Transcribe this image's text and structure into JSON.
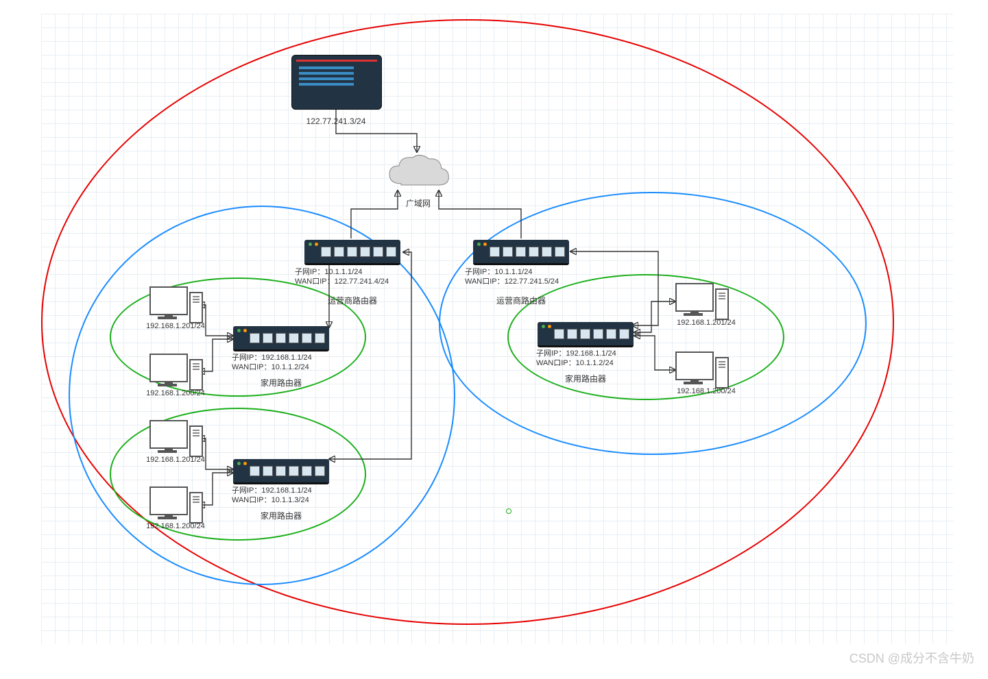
{
  "watermark": "CSDN @成分不含牛奶",
  "server": {
    "ip": "122.77.241.3/24"
  },
  "cloud": {
    "label": "广域网"
  },
  "ispRouterLeft": {
    "subnet": "子网IP：10.1.1.1/24",
    "wan": "WAN口IP：122.77.241.4/24",
    "title": "运营商路由器"
  },
  "ispRouterRight": {
    "subnet": "子网IP：10.1.1.1/24",
    "wan": "WAN口IP：122.77.241.5/24",
    "title": "运营商路由器"
  },
  "homeRouterA": {
    "subnet": "子网IP：192.168.1.1/24",
    "wan": "WAN口IP：10.1.1.2/24",
    "title": "家用路由器"
  },
  "homeRouterB": {
    "subnet": "子网IP：192.168.1.1/24",
    "wan": "WAN口IP：10.1.1.3/24",
    "title": "家用路由器"
  },
  "homeRouterC": {
    "subnet": "子网IP：192.168.1.1/24",
    "wan": "WAN口IP：10.1.1.2/24",
    "title": "家用路由器"
  },
  "pc": {
    "a1": "192.168.1.201/24",
    "a2": "192.168.1.200/24",
    "b1": "192.168.1.201/24",
    "b2": "192.168.1.200/24",
    "c1": "192.168.1.201/24",
    "c2": "192.168.1.200/24"
  }
}
